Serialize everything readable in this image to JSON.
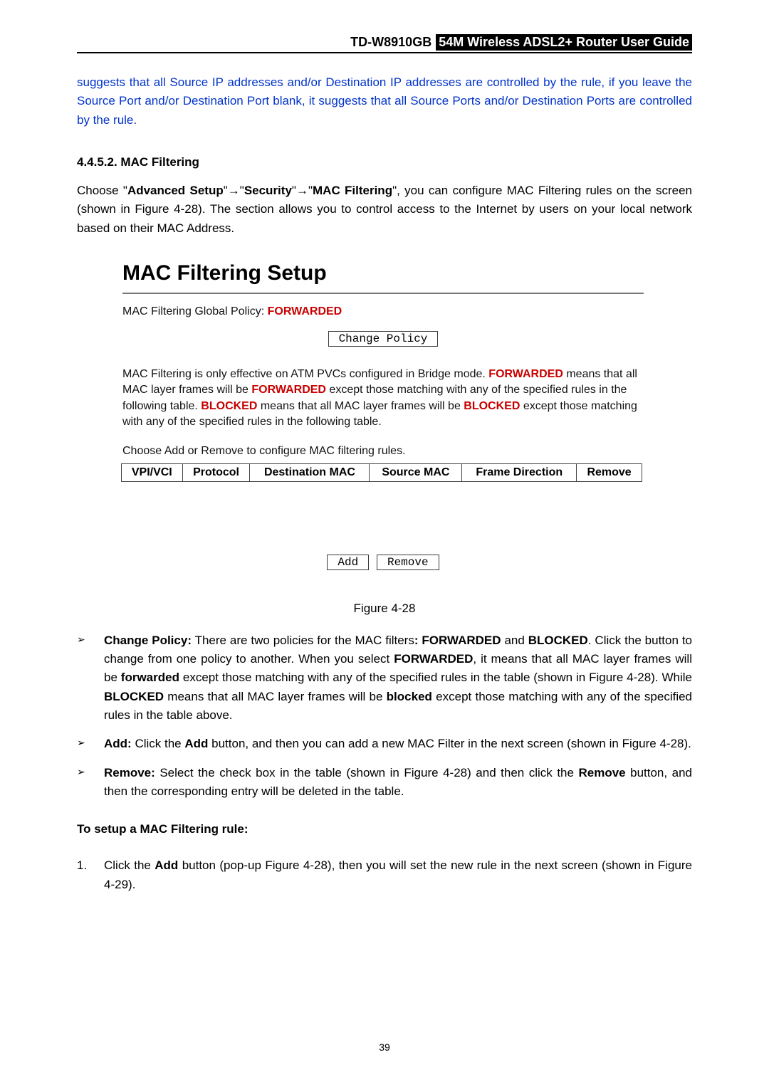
{
  "header": {
    "model": "TD-W8910GB",
    "title": "54M  Wireless  ADSL2+  Router  User  Guide"
  },
  "intro_blue": "suggests that all Source IP addresses and/or Destination IP addresses are controlled by the rule, if you leave the Source Port and/or Destination Port blank, it suggests that all Source Ports and/or Destination Ports are controlled by the rule.",
  "section_num": "4.4.5.2.  MAC Filtering",
  "para1": {
    "t1": "Choose \"",
    "b1": "Advanced Setup",
    "t2": "\"",
    "arr": "→",
    "t3": "\"",
    "b2": "Security",
    "t4": "\"",
    "t5": "\"",
    "b3": "MAC Filtering",
    "t6": "\", you can configure MAC Filtering rules on the screen (shown in Figure 4-28). The section allows you to control access to the Internet by users on your local network based on their MAC Address."
  },
  "figure": {
    "title": "MAC Filtering Setup",
    "policy_label": "MAC Filtering Global Policy: ",
    "policy_value": "FORWARDED",
    "change_btn": "Change Policy",
    "desc_a": "MAC Filtering is only effective on ATM PVCs configured in Bridge mode. ",
    "desc_b": "FORWARDED",
    "desc_c": " means that all MAC layer frames will be ",
    "desc_d": "FORWARDED",
    "desc_e": " except those matching with any of the specified rules in the following table. ",
    "desc_f": "BLOCKED",
    "desc_g": " means that all MAC layer frames will be ",
    "desc_h": "BLOCKED",
    "desc_i": " except those matching with any of the specified rules in the following table.",
    "choose": "Choose Add or Remove to configure MAC filtering rules.",
    "cols": [
      "VPI/VCI",
      "Protocol",
      "Destination MAC",
      "Source MAC",
      "Frame Direction",
      "Remove"
    ],
    "add_btn": "Add",
    "remove_btn": "Remove",
    "caption": "Figure 4-28"
  },
  "bullets": {
    "b1": {
      "lead": "Change Policy:",
      "t1": " There are two policies for the MAC filters",
      "b2": ": FORWARDED",
      "t2": " and ",
      "b3": "BLOCKED",
      "t3": ". Click the button to change from one policy to another. When you select ",
      "b4": "FORWARDED",
      "t4": ", it means that all MAC layer frames will be ",
      "b5": "forwarded",
      "t5": " except those matching with any of the specified rules in the table (shown in Figure 4-28). While ",
      "b6": "BLOCKED",
      "t6": " means that all MAC layer frames will be ",
      "b7": "blocked",
      "t7": " except those matching with any of the specified rules in the table above."
    },
    "b2": {
      "lead": "Add:",
      "t1": " Click the ",
      "b2": "Add",
      "t2": " button, and then you can add a new MAC Filter in the next screen (shown in Figure 4-28)."
    },
    "b3": {
      "lead": "Remove:",
      "t1": " Select the check box in the table (shown in Figure 4-28) and then click the ",
      "b2": "Remove",
      "t2": " button, and then the corresponding entry will be deleted in the table."
    }
  },
  "setup_heading": "To setup a MAC Filtering rule:",
  "steps": {
    "s1": {
      "n": "1.",
      "t1": "Click the ",
      "b1": "Add",
      "t2": " button (pop-up Figure 4-28), then you will set the new rule in the next screen (shown in Figure 4-29)."
    }
  },
  "page_number": "39"
}
